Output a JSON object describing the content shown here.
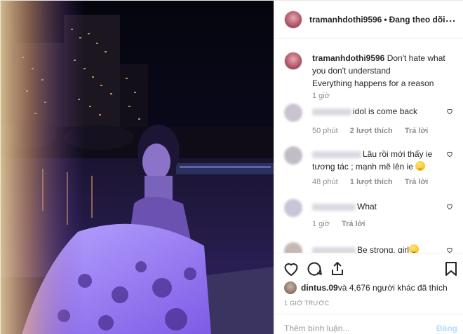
{
  "header": {
    "username": "tramanhdothi9596",
    "separator": "•",
    "follow_status": "Đang theo dõi",
    "more": "..."
  },
  "caption": {
    "username": "tramanhdothi9596",
    "text_line1": "Don't hate what you don't understand",
    "text_line2": "Everything happens for a reason",
    "time": "1 giờ"
  },
  "comments": [
    {
      "text": "idol is come back",
      "time": "50 phút",
      "likes": "2 lượt thích",
      "reply": "Trả lời"
    },
    {
      "text": "Lâu rồi mới thấy ie tương tác ; mạnh mẽ lên ie",
      "time": "48 phút",
      "likes": "1 lượt thích",
      "reply": "Trả lời"
    },
    {
      "text": "What",
      "time": "1 giờ",
      "reply": "Trả lời"
    },
    {
      "text": "Be strong, girl"
    }
  ],
  "likes": {
    "user": "dintus.09",
    "rest": " và 4,676 người khác đã thích"
  },
  "ago": "1 GIỜ TRƯỚC",
  "comment_box": {
    "placeholder": "Thêm bình luận...",
    "post_label": "Đăng"
  },
  "colors": {
    "post_button_disabled": "#b3dbff",
    "muted_text": "#8e8e8e"
  }
}
